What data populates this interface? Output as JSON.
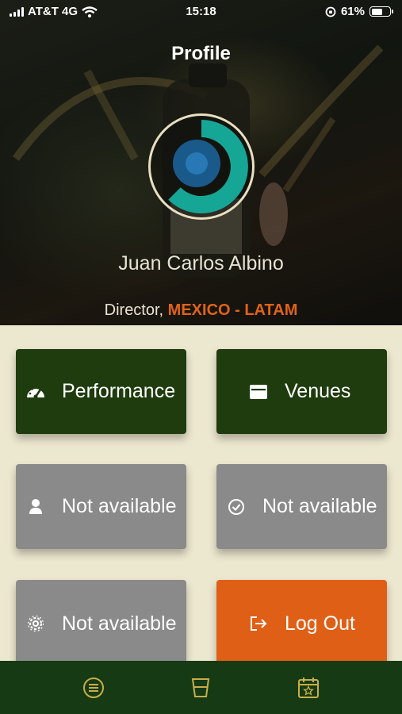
{
  "status_bar": {
    "carrier": "AT&T 4G",
    "time": "15:18",
    "battery_text": "61%",
    "battery_level": 0.61
  },
  "header": {
    "title": "Profile"
  },
  "profile": {
    "name": "Juan Carlos Albino",
    "role": "Director,",
    "region": "MEXICO - LATAM"
  },
  "tiles": [
    {
      "label": "Performance",
      "icon": "speedometer-icon",
      "state": "active"
    },
    {
      "label": "Venues",
      "icon": "wallet-icon",
      "state": "active"
    },
    {
      "label": "Not available",
      "icon": "user-icon",
      "state": "disabled"
    },
    {
      "label": "Not available",
      "icon": "check-circle-icon",
      "state": "disabled"
    },
    {
      "label": "Not available",
      "icon": "gear-icon",
      "state": "disabled"
    },
    {
      "label": "Log Out",
      "icon": "logout-icon",
      "state": "action"
    }
  ],
  "bottom_nav": [
    "menu-icon",
    "glass-icon",
    "calendar-star-icon"
  ],
  "colors": {
    "accent_orange": "#e05f16",
    "tile_green": "#1f3c0e",
    "tile_gray": "#8a8a8a",
    "nav_green": "#163b14",
    "background": "#ece7cf"
  }
}
